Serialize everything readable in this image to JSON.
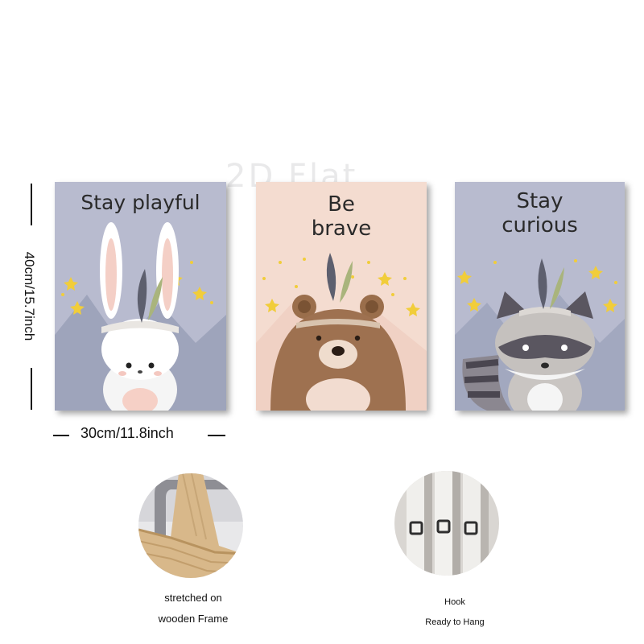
{
  "watermark": "2D Flat",
  "panels": [
    {
      "caption": "Stay playful",
      "animal": "rabbit",
      "bg": "#b9bccf"
    },
    {
      "caption_line1": "Be",
      "caption_line2": "brave",
      "animal": "bear",
      "bg": "#f4dcd0"
    },
    {
      "caption_line1": "Stay",
      "caption_line2": "curious",
      "animal": "raccoon",
      "bg": "#b9bccf"
    }
  ],
  "dimensions": {
    "height_label": "40cm/15.7inch",
    "width_label": "30cm/11.8inch"
  },
  "features": [
    {
      "label_line1": "stretched on",
      "label_line2": "wooden Frame",
      "icon": "wooden-frame-corner"
    },
    {
      "label_line1": "Hook",
      "label_line2": "Ready to Hang",
      "icon": "hanging-hook"
    }
  ]
}
